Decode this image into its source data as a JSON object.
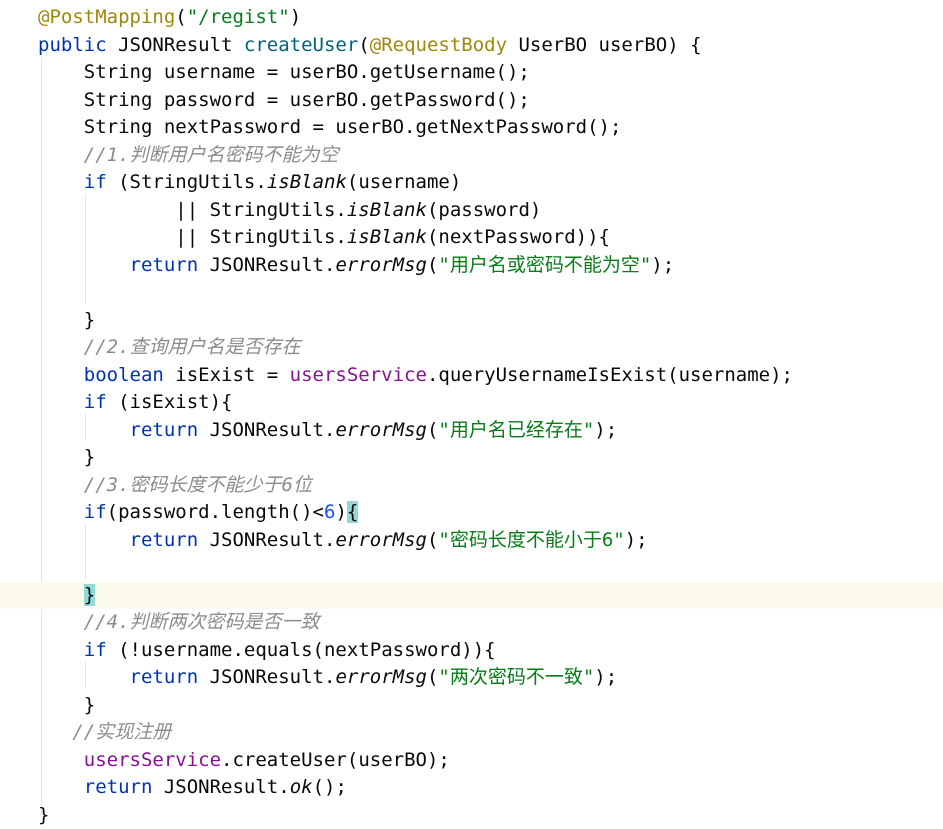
{
  "editor": {
    "lines": [
      [
        {
          "t": "@PostMapping",
          "s": "annotation"
        },
        {
          "t": "(",
          "s": "plain"
        },
        {
          "t": "\"/regist\"",
          "s": "string"
        },
        {
          "t": ")",
          "s": "plain"
        }
      ],
      [
        {
          "t": "public ",
          "s": "keyword"
        },
        {
          "t": "JSONResult ",
          "s": "plain"
        },
        {
          "t": "createUser",
          "s": "method"
        },
        {
          "t": "(",
          "s": "plain"
        },
        {
          "t": "@RequestBody ",
          "s": "annotation"
        },
        {
          "t": "UserBO userBO) {",
          "s": "plain"
        }
      ],
      [
        {
          "t": "    String username = userBO.getUsername();",
          "s": "plain"
        }
      ],
      [
        {
          "t": "    String password = userBO.getPassword();",
          "s": "plain"
        }
      ],
      [
        {
          "t": "    String nextPassword = userBO.getNextPassword();",
          "s": "plain"
        }
      ],
      [
        {
          "t": "    //1.判断用户名密码不能为空",
          "s": "comment"
        }
      ],
      [
        {
          "t": "    ",
          "s": "plain"
        },
        {
          "t": "if ",
          "s": "keyword"
        },
        {
          "t": "(StringUtils.",
          "s": "plain"
        },
        {
          "t": "isBlank",
          "s": "static"
        },
        {
          "t": "(username)",
          "s": "plain"
        }
      ],
      [
        {
          "t": "            || StringUtils.",
          "s": "plain"
        },
        {
          "t": "isBlank",
          "s": "static"
        },
        {
          "t": "(password)",
          "s": "plain"
        }
      ],
      [
        {
          "t": "            || StringUtils.",
          "s": "plain"
        },
        {
          "t": "isBlank",
          "s": "static"
        },
        {
          "t": "(nextPassword)){",
          "s": "plain"
        }
      ],
      [
        {
          "t": "        ",
          "s": "plain"
        },
        {
          "t": "return ",
          "s": "keyword"
        },
        {
          "t": "JSONResult.",
          "s": "plain"
        },
        {
          "t": "errorMsg",
          "s": "static"
        },
        {
          "t": "(",
          "s": "plain"
        },
        {
          "t": "\"用户名或密码不能为空\"",
          "s": "string"
        },
        {
          "t": ");",
          "s": "plain"
        }
      ],
      [],
      [
        {
          "t": "    }",
          "s": "plain"
        }
      ],
      [
        {
          "t": "    //2.查询用户名是否存在",
          "s": "comment"
        }
      ],
      [
        {
          "t": "    ",
          "s": "plain"
        },
        {
          "t": "boolean ",
          "s": "keyword"
        },
        {
          "t": "isExist = ",
          "s": "plain"
        },
        {
          "t": "usersService",
          "s": "field"
        },
        {
          "t": ".queryUsernameIsExist(username);",
          "s": "plain"
        }
      ],
      [
        {
          "t": "    ",
          "s": "plain"
        },
        {
          "t": "if ",
          "s": "keyword"
        },
        {
          "t": "(isExist){",
          "s": "plain"
        }
      ],
      [
        {
          "t": "        ",
          "s": "plain"
        },
        {
          "t": "return ",
          "s": "keyword"
        },
        {
          "t": "JSONResult.",
          "s": "plain"
        },
        {
          "t": "errorMsg",
          "s": "static"
        },
        {
          "t": "(",
          "s": "plain"
        },
        {
          "t": "\"用户名已经存在\"",
          "s": "string"
        },
        {
          "t": ");",
          "s": "plain"
        }
      ],
      [
        {
          "t": "    }",
          "s": "plain"
        }
      ],
      [
        {
          "t": "    //3.密码长度不能少于6位",
          "s": "comment"
        }
      ],
      [
        {
          "t": "    ",
          "s": "plain"
        },
        {
          "t": "if",
          "s": "keyword"
        },
        {
          "t": "(password.length()<",
          "s": "plain"
        },
        {
          "t": "6",
          "s": "number"
        },
        {
          "t": ")",
          "s": "plain"
        },
        {
          "t": "{",
          "s": "brace-match"
        }
      ],
      [
        {
          "t": "        ",
          "s": "plain"
        },
        {
          "t": "return ",
          "s": "keyword"
        },
        {
          "t": "JSONResult.",
          "s": "plain"
        },
        {
          "t": "errorMsg",
          "s": "static"
        },
        {
          "t": "(",
          "s": "plain"
        },
        {
          "t": "\"密码长度不能小于6\"",
          "s": "string"
        },
        {
          "t": ");",
          "s": "plain"
        }
      ],
      [],
      [
        {
          "t": "    ",
          "s": "plain"
        },
        {
          "t": "}",
          "s": "brace-match"
        }
      ],
      [
        {
          "t": "    //4.判断两次密码是否一致",
          "s": "comment"
        }
      ],
      [
        {
          "t": "    ",
          "s": "plain"
        },
        {
          "t": "if ",
          "s": "keyword"
        },
        {
          "t": "(!username.equals(nextPassword)){",
          "s": "plain"
        }
      ],
      [
        {
          "t": "        ",
          "s": "plain"
        },
        {
          "t": "return ",
          "s": "keyword"
        },
        {
          "t": "JSONResult.",
          "s": "plain"
        },
        {
          "t": "errorMsg",
          "s": "static"
        },
        {
          "t": "(",
          "s": "plain"
        },
        {
          "t": "\"两次密码不一致\"",
          "s": "string"
        },
        {
          "t": ");",
          "s": "plain"
        }
      ],
      [
        {
          "t": "    }",
          "s": "plain"
        }
      ],
      [
        {
          "t": "   //实现注册",
          "s": "comment"
        }
      ],
      [
        {
          "t": "    ",
          "s": "plain"
        },
        {
          "t": "usersService",
          "s": "field"
        },
        {
          "t": ".createUser(userBO);",
          "s": "plain"
        }
      ],
      [
        {
          "t": "    ",
          "s": "plain"
        },
        {
          "t": "return ",
          "s": "keyword"
        },
        {
          "t": "JSONResult.",
          "s": "plain"
        },
        {
          "t": "ok",
          "s": "static"
        },
        {
          "t": "();",
          "s": "plain"
        }
      ],
      [
        {
          "t": "}",
          "s": "plain"
        }
      ]
    ],
    "current_line": 21
  }
}
